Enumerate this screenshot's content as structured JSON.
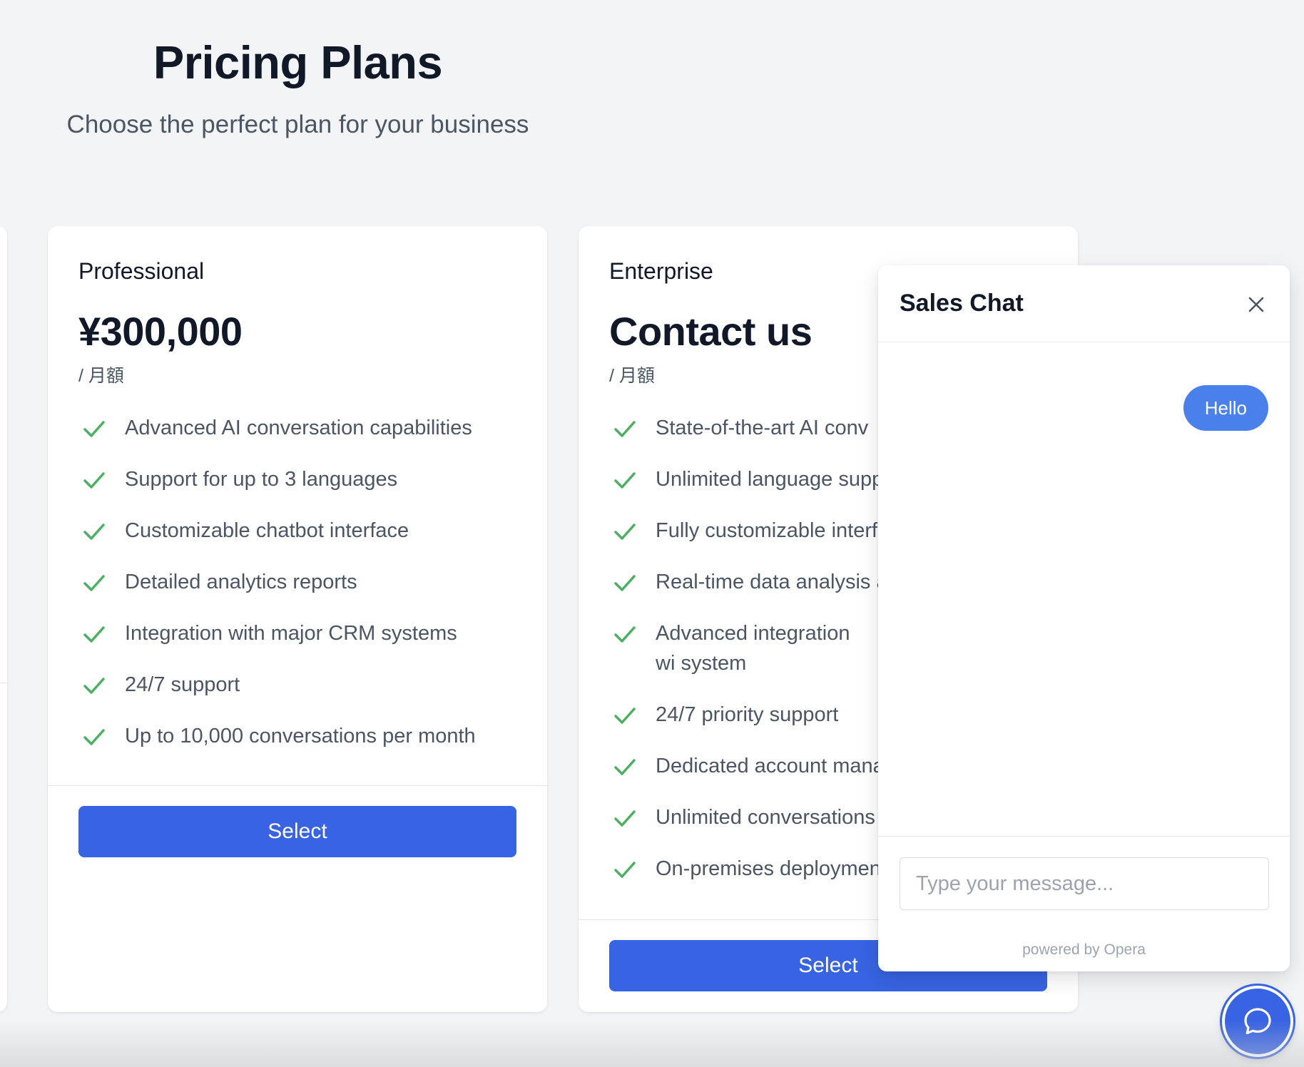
{
  "header": {
    "title": "Pricing Plans",
    "subtitle": "Choose the perfect plan for your business"
  },
  "plans": [
    {
      "name": "Professional",
      "price": "¥300,000",
      "period": "/ 月額",
      "features": [
        "Advanced AI conversation capabilities",
        "Support for up to 3 languages",
        "Customizable chatbot interface",
        "Detailed analytics reports",
        "Integration with major CRM systems",
        "24/7 support",
        "Up to 10,000 conversations per month"
      ],
      "button_label": "Select"
    },
    {
      "name": "Enterprise",
      "price": "Contact us",
      "period": "/ 月額",
      "features": [
        "State-of-the-art AI conv",
        "Unlimited language supp",
        "Fully customizable interf",
        "Real-time data analysis a",
        "Advanced integration wi system",
        "24/7 priority support",
        "Dedicated account mana",
        "Unlimited conversations",
        "On-premises deploymen"
      ],
      "button_label": "Select"
    }
  ],
  "chat": {
    "title": "Sales Chat",
    "messages": [
      {
        "from": "user",
        "text": "Hello"
      }
    ],
    "input_placeholder": "Type your message...",
    "powered_by": "powered by Opera"
  },
  "icons": {
    "feature": "check-icon",
    "close": "close-icon",
    "launcher": "chat-bubble-icon"
  },
  "colors": {
    "primary": "#3863e2",
    "chat_bubble": "#4a80ec",
    "check": "#4caf62",
    "background": "#f3f4f6"
  }
}
